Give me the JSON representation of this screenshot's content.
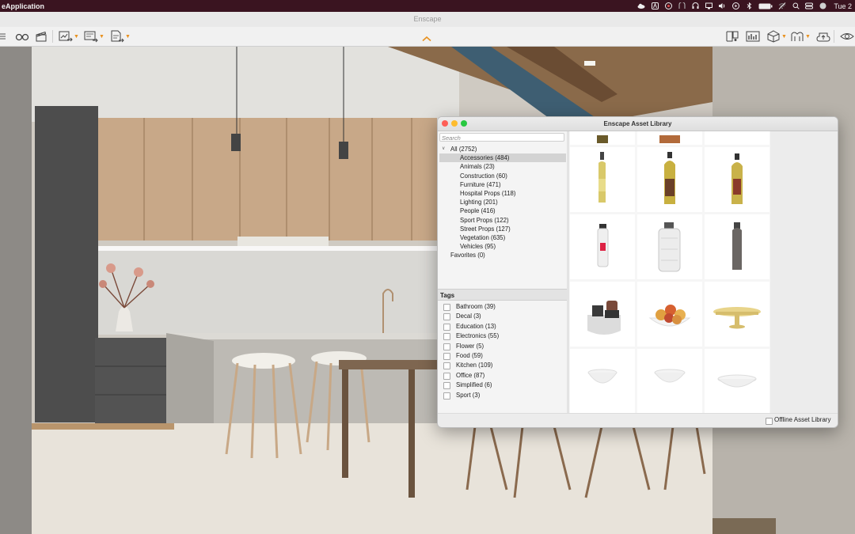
{
  "menubar": {
    "app_name": "eApplication",
    "clock": "Tue 2",
    "status_icons": [
      "cloud-icon",
      "a-icon",
      "chrome-icon",
      "vpn-icon",
      "headphones-icon",
      "display-icon",
      "volume-icon",
      "play-icon",
      "bluetooth-icon",
      "battery-icon",
      "wifi-icon",
      "search-icon",
      "control-center-icon",
      "siri-icon"
    ]
  },
  "window": {
    "title": "Enscape"
  },
  "library": {
    "title": "Enscape Asset Library",
    "search_placeholder": "Search",
    "tree": [
      {
        "label": "All (2752)",
        "level": 0,
        "expanded": true
      },
      {
        "label": "Accessories (484)",
        "level": 1,
        "selected": true
      },
      {
        "label": "Animals (23)",
        "level": 1
      },
      {
        "label": "Construction (60)",
        "level": 1
      },
      {
        "label": "Furniture (471)",
        "level": 1
      },
      {
        "label": "Hospital Props (118)",
        "level": 1
      },
      {
        "label": "Lighting (201)",
        "level": 1
      },
      {
        "label": "People (416)",
        "level": 1
      },
      {
        "label": "Sport Props (122)",
        "level": 1
      },
      {
        "label": "Street Props (127)",
        "level": 1
      },
      {
        "label": "Vegetation (635)",
        "level": 1
      },
      {
        "label": "Vehicles (95)",
        "level": 1
      },
      {
        "label": "Favorites (0)",
        "level": 0
      }
    ],
    "tags_heading": "Tags",
    "tags": [
      "Bathroom (39)",
      "Decal (3)",
      "Education (13)",
      "Electronics (55)",
      "Flower (5)",
      "Food (59)",
      "Kitchen (109)",
      "Office (87)",
      "Simplified (6)",
      "Sport (3)"
    ],
    "assets": [
      "oil-bottle-small",
      "oil-bottle-label",
      "oil-bottle-tall",
      "sports-bottle-white",
      "water-jug",
      "steel-bottle-grey",
      "pepper-mill-set",
      "fruit-bowl",
      "cake-stand",
      "bowl-white-1",
      "bowl-white-2",
      "bowl-white-3"
    ],
    "offline_label": "Offline Asset Library",
    "offline_checked": false
  },
  "colors": {
    "menubar_bg": "#3a1420",
    "accent": "#e8911f",
    "selection": "#d3d3d3"
  }
}
